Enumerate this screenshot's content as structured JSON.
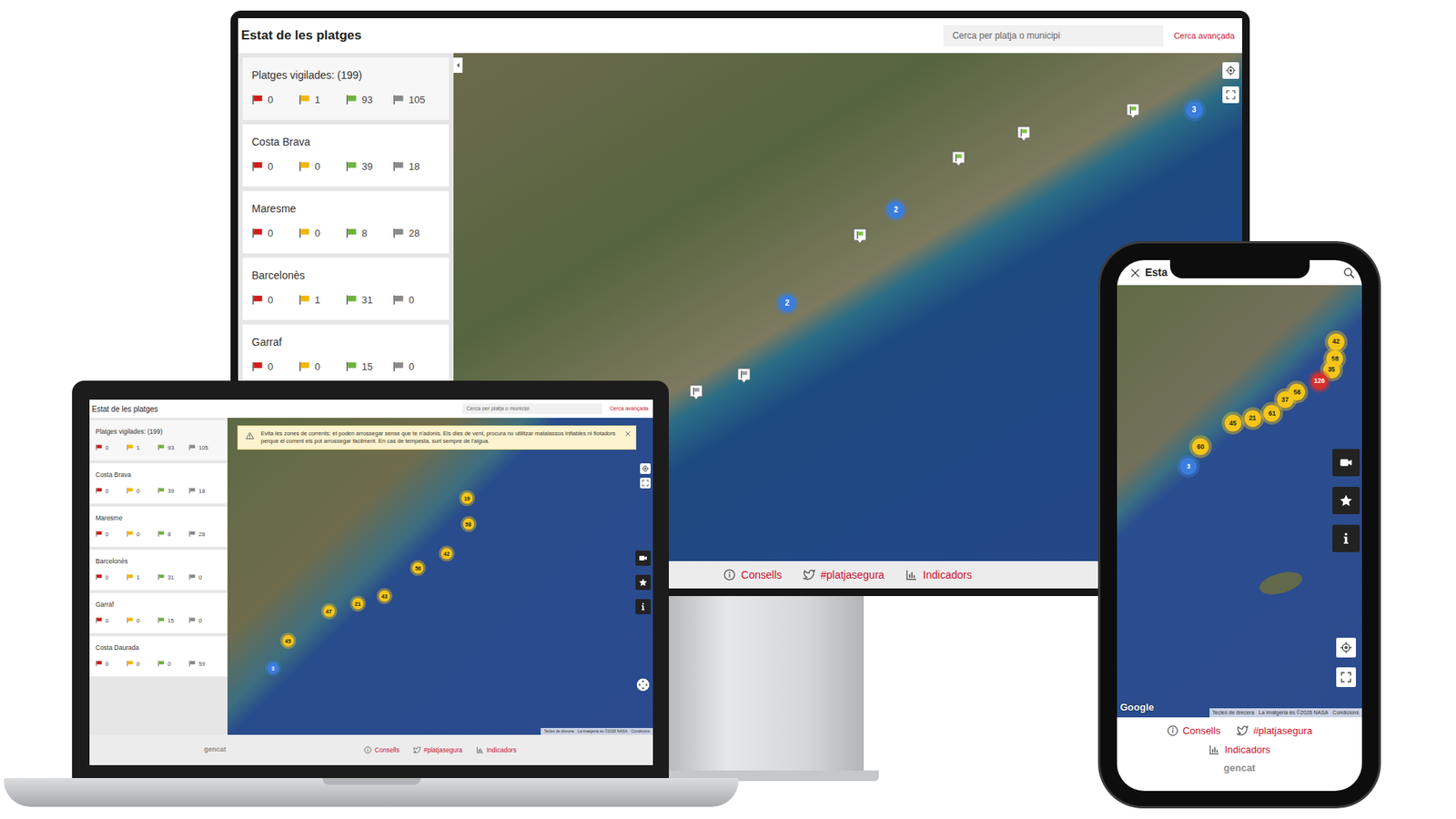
{
  "monitor": {
    "header": {
      "title": "Estat de les platges",
      "search_placeholder": "Cerca per platja o municipi",
      "advanced_search": "Cerca avançada"
    },
    "regions": [
      {
        "name": "Platges vigilades: (199)",
        "flags": [
          {
            "count": "0",
            "color": "#cc1f1a"
          },
          {
            "count": "1",
            "color": "#f2b705"
          },
          {
            "count": "93",
            "color": "#6db33f"
          },
          {
            "count": "105",
            "color": "#8a8a8a"
          }
        ]
      },
      {
        "name": "Costa Brava",
        "flags": [
          {
            "count": "0",
            "color": "#cc1f1a"
          },
          {
            "count": "0",
            "color": "#f2b705"
          },
          {
            "count": "39",
            "color": "#6db33f"
          },
          {
            "count": "18",
            "color": "#8a8a8a"
          }
        ]
      },
      {
        "name": "Maresme",
        "flags": [
          {
            "count": "0",
            "color": "#cc1f1a"
          },
          {
            "count": "0",
            "color": "#f2b705"
          },
          {
            "count": "8",
            "color": "#6db33f"
          },
          {
            "count": "28",
            "color": "#8a8a8a"
          }
        ]
      },
      {
        "name": "Barcelonès",
        "flags": [
          {
            "count": "0",
            "color": "#cc1f1a"
          },
          {
            "count": "1",
            "color": "#f2b705"
          },
          {
            "count": "31",
            "color": "#6db33f"
          },
          {
            "count": "0",
            "color": "#8a8a8a"
          }
        ]
      },
      {
        "name": "Garraf",
        "flags": [
          {
            "count": "0",
            "color": "#cc1f1a"
          },
          {
            "count": "0",
            "color": "#f2b705"
          },
          {
            "count": "15",
            "color": "#6db33f"
          },
          {
            "count": "0",
            "color": "#8a8a8a"
          }
        ]
      }
    ],
    "pins": [
      {
        "kind": "flag",
        "color": "#7cc242"
      },
      {
        "kind": "cluster",
        "label": "3",
        "color": "#3b7ddd"
      },
      {
        "kind": "flag",
        "color": "#7cc242"
      },
      {
        "kind": "flag",
        "color": "#7cc242"
      },
      {
        "kind": "cluster",
        "label": "2",
        "color": "#3b7ddd"
      },
      {
        "kind": "flag",
        "color": "#7cc242"
      },
      {
        "kind": "cluster",
        "label": "2",
        "color": "#3b7ddd"
      },
      {
        "kind": "flag",
        "color": "#9e9e9e"
      },
      {
        "kind": "flag",
        "color": "#9e9e9e"
      }
    ],
    "footer": {
      "links": [
        "Consells",
        "#platjasegura",
        "Indicadors"
      ]
    }
  },
  "laptop": {
    "header": {
      "title": "Estat de les platges",
      "search_placeholder": "Cerca per platja o municipi",
      "advanced_search": "Cerca avançada"
    },
    "regions": [
      {
        "name": "Platges vigilades: (199)",
        "flags": [
          {
            "count": "0",
            "color": "#cc1f1a"
          },
          {
            "count": "1",
            "color": "#f2b705"
          },
          {
            "count": "93",
            "color": "#6db33f"
          },
          {
            "count": "105",
            "color": "#8a8a8a"
          }
        ]
      },
      {
        "name": "Costa Brava",
        "flags": [
          {
            "count": "0",
            "color": "#cc1f1a"
          },
          {
            "count": "0",
            "color": "#f2b705"
          },
          {
            "count": "39",
            "color": "#6db33f"
          },
          {
            "count": "18",
            "color": "#8a8a8a"
          }
        ]
      },
      {
        "name": "Maresme",
        "flags": [
          {
            "count": "0",
            "color": "#cc1f1a"
          },
          {
            "count": "0",
            "color": "#f2b705"
          },
          {
            "count": "8",
            "color": "#6db33f"
          },
          {
            "count": "28",
            "color": "#8a8a8a"
          }
        ]
      },
      {
        "name": "Barcelonès",
        "flags": [
          {
            "count": "0",
            "color": "#cc1f1a"
          },
          {
            "count": "1",
            "color": "#f2b705"
          },
          {
            "count": "31",
            "color": "#6db33f"
          },
          {
            "count": "0",
            "color": "#8a8a8a"
          }
        ]
      },
      {
        "name": "Garraf",
        "flags": [
          {
            "count": "0",
            "color": "#cc1f1a"
          },
          {
            "count": "0",
            "color": "#f2b705"
          },
          {
            "count": "15",
            "color": "#6db33f"
          },
          {
            "count": "0",
            "color": "#8a8a8a"
          }
        ]
      },
      {
        "name": "Costa Daurada",
        "flags": [
          {
            "count": "0",
            "color": "#cc1f1a"
          },
          {
            "count": "0",
            "color": "#f2b705"
          },
          {
            "count": "0",
            "color": "#6db33f"
          },
          {
            "count": "59",
            "color": "#8a8a8a"
          }
        ]
      }
    ],
    "alert": {
      "text": "Evita les zones de corrents: et poden arrossegar sense que te n'adonis. Els dies de vent, procura no utilitzar matalassos inflables ni flotadors perquè el corrent els pot arrossegar fàcilment. En cas de tempesta, surt sempre de l'aigua."
    },
    "pins": [
      {
        "kind": "cluster",
        "label": "19",
        "color": "#f5c518"
      },
      {
        "kind": "cluster",
        "label": "58",
        "color": "#f5c518"
      },
      {
        "kind": "cluster",
        "label": "42",
        "color": "#f5c518"
      },
      {
        "kind": "cluster",
        "label": "56",
        "color": "#f5c518"
      },
      {
        "kind": "cluster",
        "label": "43",
        "color": "#f5c518"
      },
      {
        "kind": "cluster",
        "label": "21",
        "color": "#f5c518"
      },
      {
        "kind": "cluster",
        "label": "47",
        "color": "#f5c518"
      },
      {
        "kind": "cluster",
        "label": "45",
        "color": "#f5c518"
      },
      {
        "kind": "cluster",
        "label": "3",
        "color": "#3b7ddd"
      }
    ],
    "attribution": [
      "Tecles de drecera",
      "La imatgeria és ©2026 NASA",
      "Condicions"
    ],
    "footer": {
      "logo": "gencat",
      "links": [
        "Consells",
        "#platjasegura",
        "Indicadors"
      ]
    }
  },
  "phone": {
    "header": {
      "title": "Esta"
    },
    "pins": [
      {
        "kind": "cluster",
        "label": "42",
        "color": "#f5c518"
      },
      {
        "kind": "cluster",
        "label": "58",
        "color": "#f5c518"
      },
      {
        "kind": "cluster",
        "label": "35",
        "color": "#f5c518"
      },
      {
        "kind": "cluster",
        "label": "126",
        "color": "#d32f2f"
      },
      {
        "kind": "cluster",
        "label": "56",
        "color": "#f5c518"
      },
      {
        "kind": "cluster",
        "label": "37",
        "color": "#f5c518"
      },
      {
        "kind": "cluster",
        "label": "61",
        "color": "#f5c518"
      },
      {
        "kind": "cluster",
        "label": "21",
        "color": "#f5c518"
      },
      {
        "kind": "cluster",
        "label": "45",
        "color": "#f5c518"
      },
      {
        "kind": "cluster",
        "label": "60",
        "color": "#f5c518"
      },
      {
        "kind": "cluster",
        "label": "3",
        "color": "#3b7ddd"
      }
    ],
    "google": "Google",
    "attribution": [
      "Tecles de drecera",
      "La imatgeria és ©2026 NASA",
      "Condicions"
    ],
    "footer": {
      "logo": "gencat",
      "links": [
        "Consells",
        "#platjasegura",
        "Indicadors"
      ]
    }
  }
}
